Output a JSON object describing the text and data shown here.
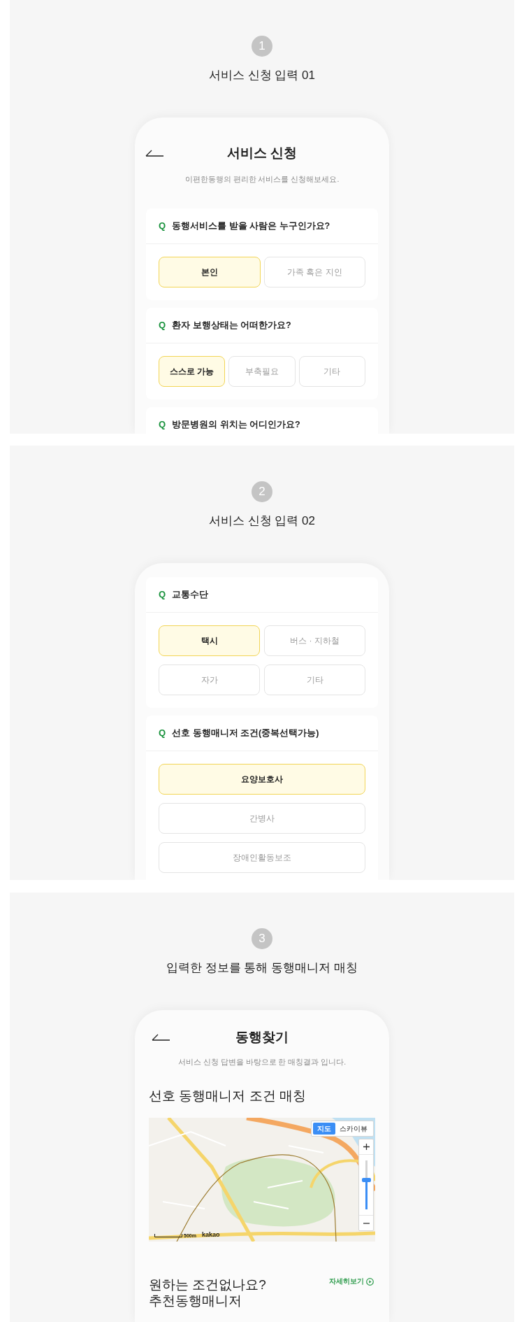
{
  "sections": [
    {
      "number": "1",
      "title": "서비스 신청 입력 01",
      "screen": {
        "kind": "form",
        "header": {
          "title": "서비스 신청",
          "subtitle": "이편한동행의 편리한 서비스를 신청해보세요."
        },
        "questions": [
          {
            "marker": "Q",
            "label": "동행서비스를 받을 사람은 누구인가요?",
            "kind": "row",
            "options": [
              {
                "label": "본인",
                "selected": true
              },
              {
                "label": "가족 혹은 지인",
                "selected": false
              }
            ]
          },
          {
            "marker": "Q",
            "label": "환자 보행상태는 어떠한가요?",
            "kind": "row",
            "options": [
              {
                "label": "스스로 가능",
                "selected": true
              },
              {
                "label": "부축필요",
                "selected": false
              },
              {
                "label": "기타",
                "selected": false
              }
            ]
          },
          {
            "marker": "Q",
            "label": "방문병원의 위치는 어디인가요?"
          }
        ]
      }
    },
    {
      "number": "2",
      "title": "서비스 신청 입력 02",
      "screen": {
        "kind": "form",
        "questions": [
          {
            "marker": "Q",
            "label": "교통수단",
            "kind": "grid",
            "options": [
              {
                "label": "택시",
                "selected": true
              },
              {
                "label": "버스 · 지하철",
                "selected": false
              },
              {
                "label": "자가",
                "selected": false
              },
              {
                "label": "기타",
                "selected": false
              }
            ]
          },
          {
            "marker": "Q",
            "label": "선호 동행매니저 조건(중복선택가능)",
            "kind": "list",
            "options": [
              {
                "label": "요양보호사",
                "selected": true
              },
              {
                "label": "간병사",
                "selected": false
              },
              {
                "label": "장애인활동보조",
                "selected": false
              }
            ]
          }
        ]
      }
    },
    {
      "number": "3",
      "title": "입력한 정보를 통해 동행매니저 매칭",
      "screen": {
        "kind": "matching",
        "header": {
          "title": "동행찾기",
          "subtitle": "서비스 신청 답변을 바탕으로 한 매칭결과 입니다."
        },
        "heading": "선호 동행매니저 조건 매칭",
        "map": {
          "view_toggle": [
            {
              "label": "지도",
              "selected": true
            },
            {
              "label": "스카이뷰",
              "selected": false
            }
          ],
          "zoom": {
            "level": 0.6
          },
          "scale": "500m",
          "attribution": "kakao"
        },
        "recommend": {
          "title_lines": [
            "원하는 조건없나요?",
            "추천동행매니저"
          ],
          "link": "자세히보기"
        }
      }
    }
  ]
}
